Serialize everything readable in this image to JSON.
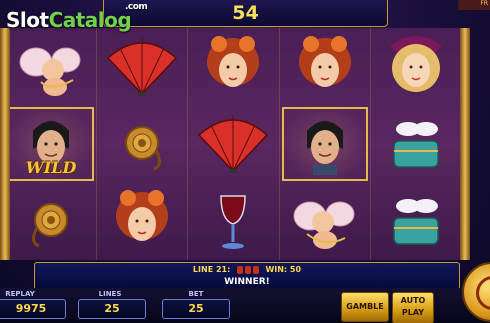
{
  "watermark": {
    "slot": "Slot",
    "catalog": "Catalog",
    "com": ".com"
  },
  "top_counter": {
    "value": "54"
  },
  "corner_flag": "FR",
  "reels": [
    [
      "cupid",
      "wild-man",
      "rose"
    ],
    [
      "fan",
      "rose",
      "woman-red"
    ],
    [
      "woman-red",
      "fan",
      "goblet"
    ],
    [
      "woman-red",
      "man",
      "cupid"
    ],
    [
      "woman-blonde",
      "doves-box",
      "doves-box"
    ]
  ],
  "wild_label": "WILD",
  "info": {
    "line_label": "LINE 21:",
    "win_label": "WIN: 50",
    "winner": "WINNER!"
  },
  "controls": {
    "autoreplay_label": "REPLAY",
    "autoreplay_value": "9975",
    "lines_label": "LINES",
    "lines_value": "25",
    "bet_label": "BET",
    "bet_value": "25",
    "gamble_label": "GAMBLE",
    "autoplay_line1": "AUTO",
    "autoplay_line2": "PLAY"
  },
  "colors": {
    "accent_gold": "#e6b94a",
    "counter_text": "#f4e15a",
    "panel_blue": "#10175a"
  }
}
